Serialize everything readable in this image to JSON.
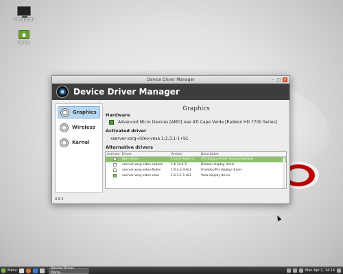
{
  "desktop": {
    "icons": [
      {
        "label": "Computer",
        "icon": "computer-icon"
      },
      {
        "label": "Home",
        "icon": "home-folder-icon"
      }
    ]
  },
  "window": {
    "title": "Device Driver Manager",
    "app_title": "Device Driver Manager",
    "version": "0.5.4"
  },
  "sidebar": {
    "items": [
      {
        "label": "Graphics",
        "active": true
      },
      {
        "label": "Wireless",
        "active": false
      },
      {
        "label": "Kernel",
        "active": false
      }
    ]
  },
  "main": {
    "title": "Graphics",
    "hardware_label": "Hardware",
    "hardware_value": "Advanced Micro Devices [AMD] nee ATI Cape Verde [Radeon HD 7700 Series]",
    "activated_label": "Activated driver",
    "activated_value": "xserver-xorg-video-vesa 1:2.3.1-1+b1",
    "alt_label": "Alternative drivers",
    "columns": [
      "Activate",
      "Driver",
      "Version",
      "Description"
    ],
    "rows": [
      {
        "driver": "fglrx-driver",
        "version": "1:12.6~beta~1",
        "description": "ATI display driver (recommended)",
        "checked": false,
        "selected": true
      },
      {
        "driver": "xserver-xorg-video-radeon",
        "version": "1:6.14.4-5",
        "description": "Radeon display driver",
        "checked": false,
        "selected": false
      },
      {
        "driver": "xserver-xorg-video-fbdev",
        "version": "1:0.4.2-4+b3",
        "description": "Framebuffer display driver",
        "checked": false,
        "selected": false
      },
      {
        "driver": "xserver-xorg-video-vesa",
        "version": "1:2.3.1-1+b1",
        "description": "Vesa display driver",
        "checked": true,
        "selected": false
      }
    ]
  },
  "taskbar": {
    "menu_label": "Menu",
    "task_label": "Device Driver Mana...",
    "clock": "Mon Apr 1, 14:14"
  }
}
